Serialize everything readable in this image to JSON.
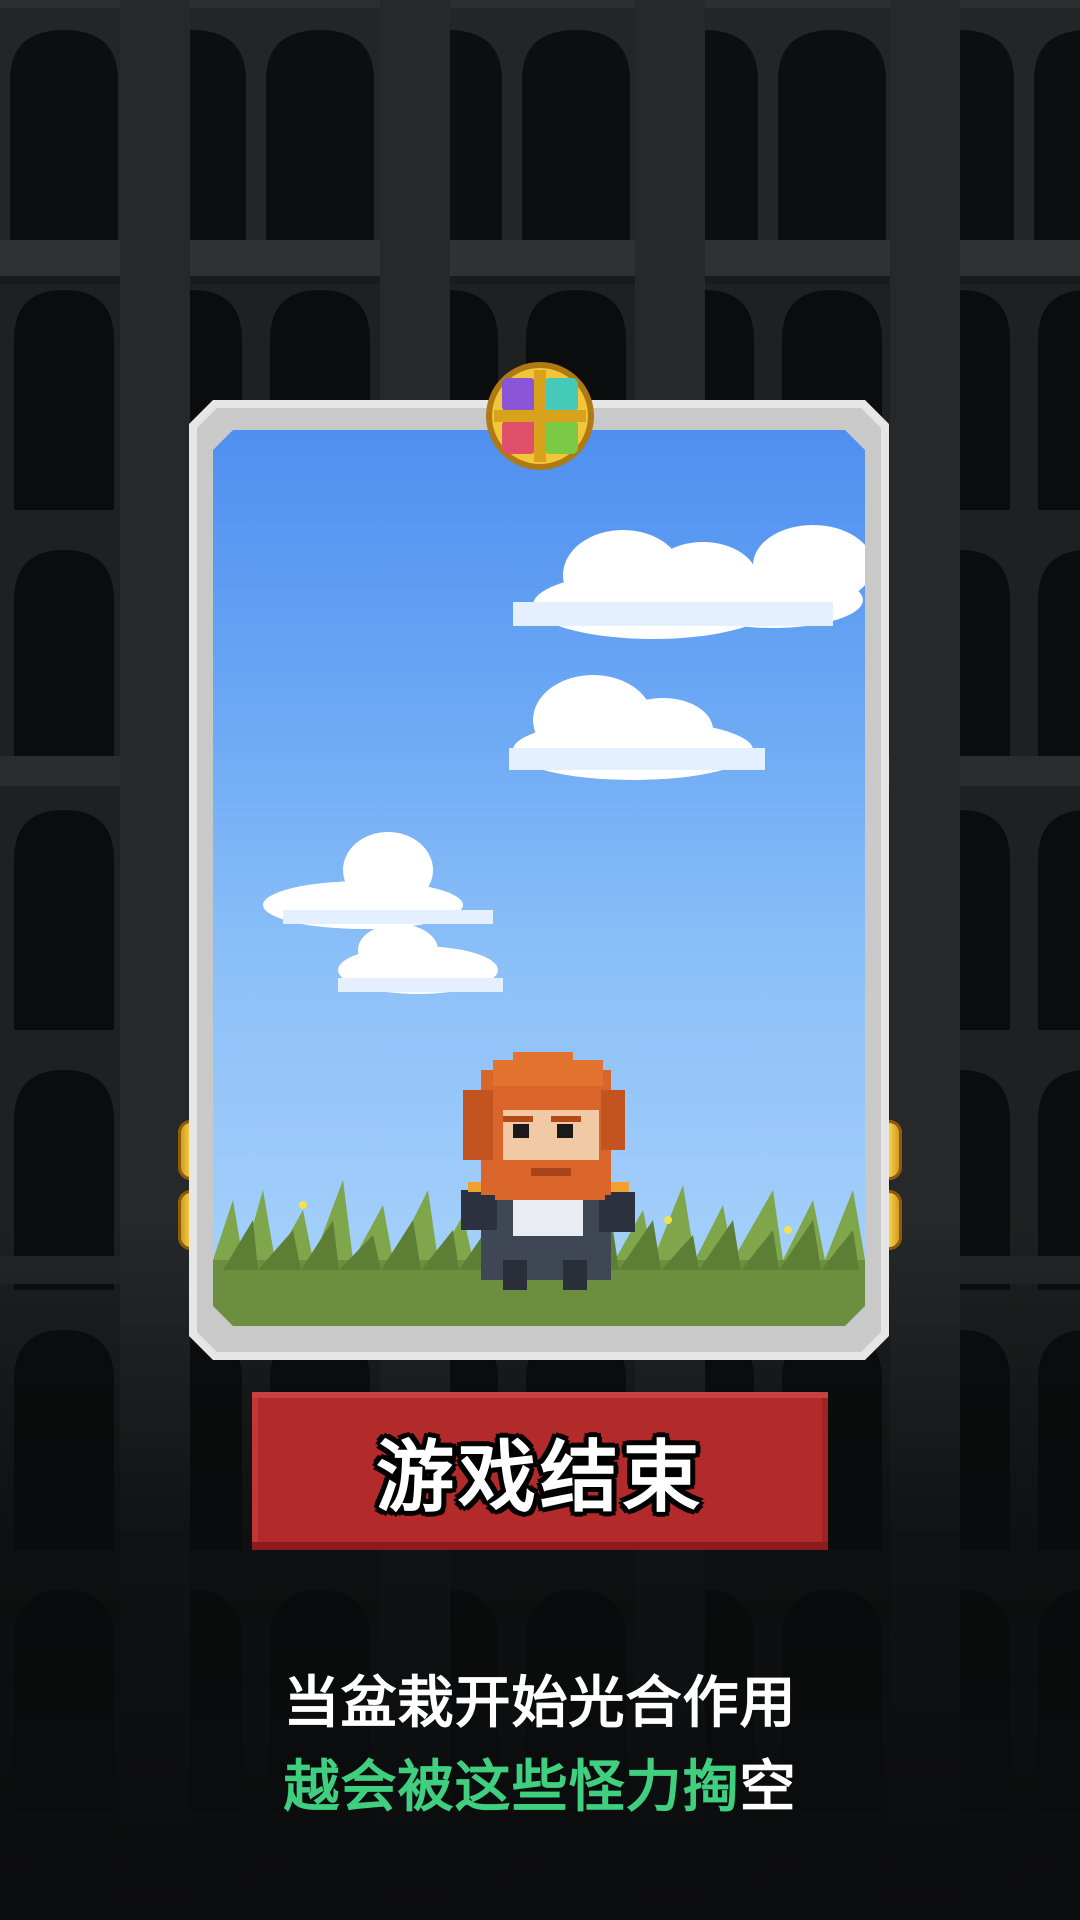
{
  "screen": "game-over",
  "banner": {
    "title": "游戏结束",
    "color": "#b32a2a"
  },
  "tagline": {
    "line1": "当盆栽开始光合作用",
    "line2_highlight": "越会被这些怪力掏",
    "line2_rest": "空",
    "highlight_color": "#3fcf7f"
  },
  "card": {
    "scene": "sky-with-clouds-and-grass",
    "character": "red-bearded-knight",
    "emblem": "four-gem-gold-emblem",
    "gem_colors": [
      "#8a55d6",
      "#45c9b8",
      "#e0506a",
      "#7cc945"
    ]
  }
}
